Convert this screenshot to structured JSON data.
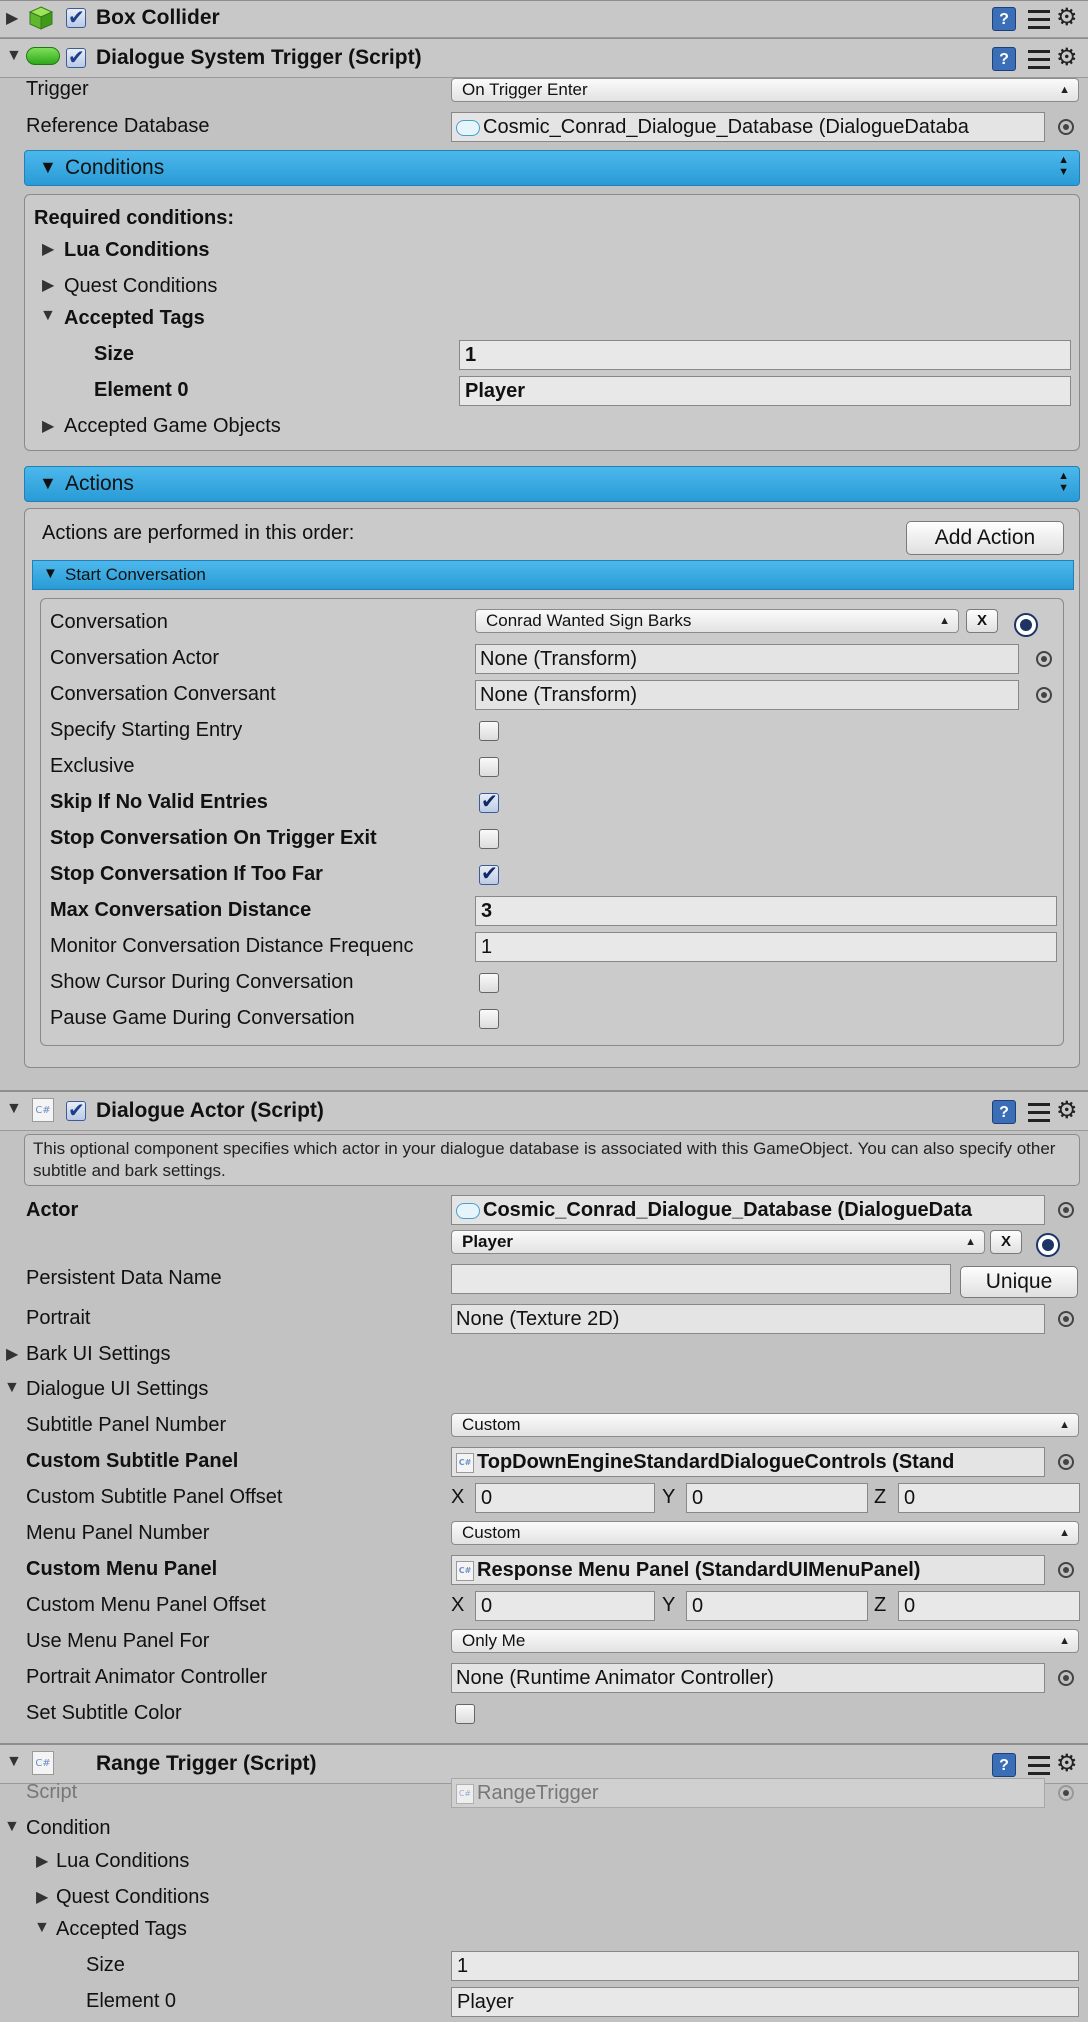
{
  "box_collider": {
    "title": "Box Collider",
    "enabled": true
  },
  "dialogue_system_trigger": {
    "title": "Dialogue System Trigger (Script)",
    "enabled": true,
    "trigger": {
      "label": "Trigger",
      "value": "On Trigger Enter"
    },
    "reference_database": {
      "label": "Reference Database",
      "value": "Cosmic_Conrad_Dialogue_Database (DialogueDataba"
    },
    "conditions": {
      "header": "Conditions",
      "required_label": "Required conditions:",
      "lua_conditions": "Lua Conditions",
      "quest_conditions": "Quest Conditions",
      "accepted_tags": "Accepted Tags",
      "size_label": "Size",
      "size_value": "1",
      "element0_label": "Element 0",
      "element0_value": "Player",
      "accepted_game_objects": "Accepted Game Objects"
    },
    "actions": {
      "header": "Actions",
      "order_text": "Actions are performed in this order:",
      "add_action": "Add Action",
      "start_conversation": "Start Conversation",
      "conversation": {
        "label": "Conversation",
        "value": "Conrad Wanted Sign Barks",
        "clear": "X"
      },
      "conversation_actor": {
        "label": "Conversation Actor",
        "value": "None (Transform)"
      },
      "conversation_conversant": {
        "label": "Conversation Conversant",
        "value": "None (Transform)"
      },
      "specify_starting_entry": {
        "label": "Specify Starting Entry",
        "checked": false
      },
      "exclusive": {
        "label": "Exclusive",
        "checked": false
      },
      "skip_if_no_valid": {
        "label": "Skip If No Valid Entries",
        "checked": true
      },
      "stop_on_trigger_exit": {
        "label": "Stop Conversation On Trigger Exit",
        "checked": false
      },
      "stop_if_too_far": {
        "label": "Stop Conversation If Too Far",
        "checked": true
      },
      "max_distance": {
        "label": "Max Conversation Distance",
        "value": "3"
      },
      "monitor_frequency": {
        "label": "Monitor Conversation Distance Frequenc",
        "value": "1"
      },
      "show_cursor": {
        "label": "Show Cursor During Conversation",
        "checked": false
      },
      "pause_game": {
        "label": "Pause Game During Conversation",
        "checked": false
      }
    }
  },
  "dialogue_actor": {
    "title": "Dialogue Actor (Script)",
    "enabled": true,
    "help": "This optional component specifies which actor in your dialogue database is associated with this GameObject. You can also specify other subtitle and bark settings.",
    "actor": {
      "label": "Actor",
      "database": "Cosmic_Conrad_Dialogue_Database (DialogueData",
      "value": "Player",
      "clear": "X"
    },
    "persistent_data_name": {
      "label": "Persistent Data Name",
      "value": "",
      "button": "Unique"
    },
    "portrait": {
      "label": "Portrait",
      "value": "None (Texture 2D)"
    },
    "bark_ui_settings": "Bark UI Settings",
    "dialogue_ui_settings": "Dialogue UI Settings",
    "subtitle_panel_number": {
      "label": "Subtitle Panel Number",
      "value": "Custom"
    },
    "custom_subtitle_panel": {
      "label": "Custom Subtitle Panel",
      "value": "TopDownEngineStandardDialogueControls (Stand"
    },
    "custom_subtitle_panel_offset": {
      "label": "Custom Subtitle Panel Offset",
      "x_label": "X",
      "x": "0",
      "y_label": "Y",
      "y": "0",
      "z_label": "Z",
      "z": "0"
    },
    "menu_panel_number": {
      "label": "Menu Panel Number",
      "value": "Custom"
    },
    "custom_menu_panel": {
      "label": "Custom Menu Panel",
      "value": "Response Menu Panel (StandardUIMenuPanel)"
    },
    "custom_menu_panel_offset": {
      "label": "Custom Menu Panel Offset",
      "x_label": "X",
      "x": "0",
      "y_label": "Y",
      "y": "0",
      "z_label": "Z",
      "z": "0"
    },
    "use_menu_panel_for": {
      "label": "Use Menu Panel For",
      "value": "Only Me"
    },
    "portrait_animator": {
      "label": "Portrait Animator Controller",
      "value": "None (Runtime Animator Controller)"
    },
    "set_subtitle_color": {
      "label": "Set Subtitle Color",
      "checked": false
    }
  },
  "range_trigger": {
    "title": "Range Trigger (Script)",
    "script": {
      "label": "Script",
      "value": "RangeTrigger"
    },
    "condition": "Condition",
    "lua_conditions": "Lua Conditions",
    "quest_conditions": "Quest Conditions",
    "accepted_tags": "Accepted Tags",
    "size_label": "Size",
    "size_value": "1",
    "element0_label": "Element 0",
    "element0_value": "Player"
  },
  "icons": [
    "fold-triangle-icon",
    "cube-icon",
    "checkbox-icon",
    "help-icon",
    "preset-icon",
    "gear-icon",
    "object-picker-icon",
    "csharp-script-icon",
    "database-icon"
  ],
  "colors": {
    "bg": "#c2c2c2",
    "accent_blue": "#2a9bd6",
    "check_blue": "#1d3f8a"
  }
}
